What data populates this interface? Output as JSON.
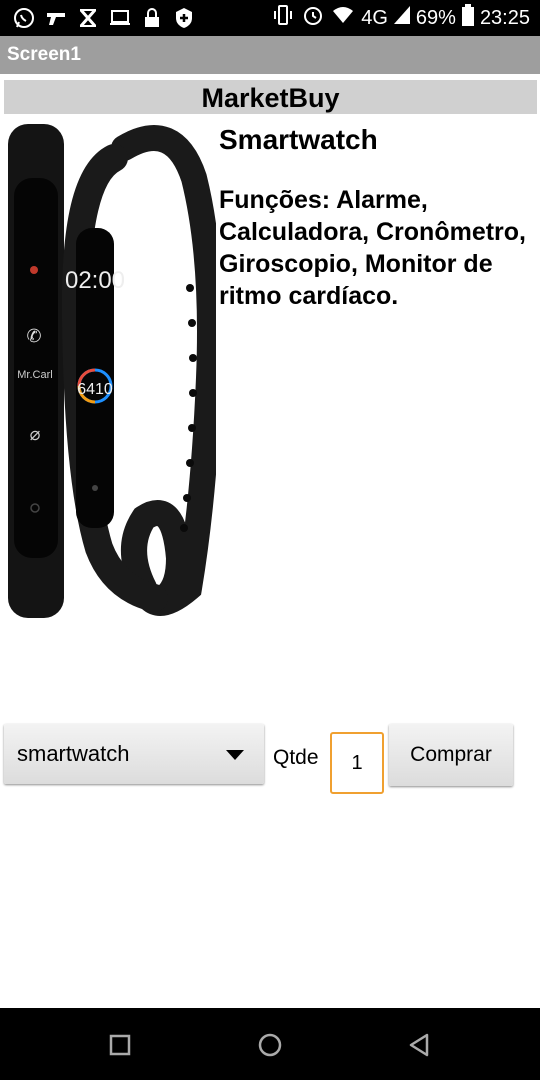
{
  "status_bar": {
    "icons": [
      "whatsapp-icon",
      "gun-icon",
      "x-icon",
      "laptop-icon",
      "lock-icon",
      "shield-plus-icon"
    ],
    "vibrate_icon": "vibrate-icon",
    "alarm_icon": "alarm-icon",
    "network": "4G",
    "battery": "69%",
    "time": "23:25"
  },
  "window": {
    "title": "Screen1"
  },
  "header": {
    "title": "MarketBuy"
  },
  "product": {
    "name": "Smartwatch",
    "description": "Funções: Alarme, Calculadora, Cronômetro, Giroscopio, Monitor de ritmo cardíaco.",
    "image_screen_time": "02:00",
    "image_screen_steps": "6410",
    "image_caller": "Mr.Carl"
  },
  "order": {
    "selected_product": "smartwatch",
    "quantity_label": "Qtde",
    "quantity_value": "1",
    "buy_label": "Comprar"
  },
  "nav": {
    "recent": "recents-icon",
    "home": "home-icon",
    "back": "back-icon"
  }
}
